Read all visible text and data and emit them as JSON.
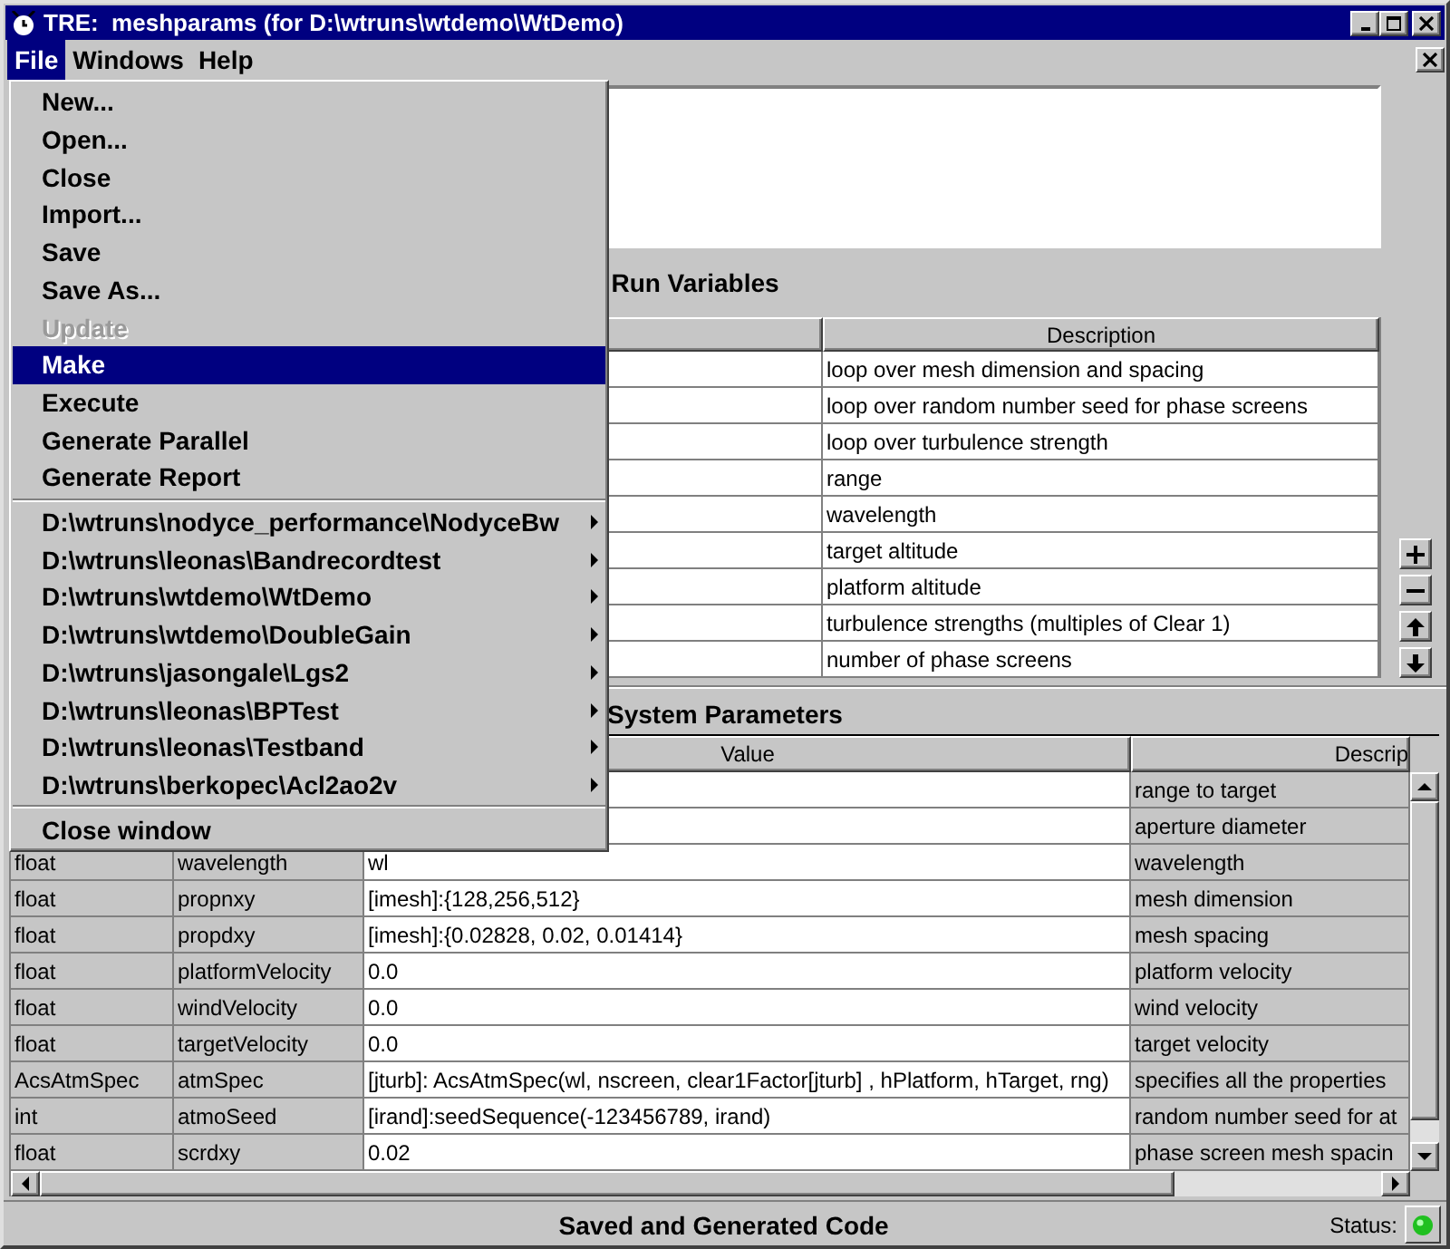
{
  "window": {
    "title": "TRE:  meshparams (for D:\\wtruns\\wtdemo\\WtDemo)"
  },
  "menubar": [
    {
      "label": "File",
      "selected": true
    },
    {
      "label": "Windows",
      "selected": false
    },
    {
      "label": "Help",
      "selected": false
    }
  ],
  "file_menu": {
    "groups": [
      [
        {
          "label": "New...",
          "kind": "command",
          "disabled": false,
          "selected": false
        },
        {
          "label": "Open...",
          "kind": "command",
          "disabled": false,
          "selected": false
        },
        {
          "label": "Close",
          "kind": "command",
          "disabled": false,
          "selected": false
        },
        {
          "label": "Import...",
          "kind": "command",
          "disabled": false,
          "selected": false
        },
        {
          "label": "Save",
          "kind": "command",
          "disabled": false,
          "selected": false
        },
        {
          "label": "Save As...",
          "kind": "command",
          "disabled": false,
          "selected": false
        },
        {
          "label": "Update",
          "kind": "command",
          "disabled": true,
          "selected": false
        },
        {
          "label": "Make",
          "kind": "command",
          "disabled": false,
          "selected": true
        },
        {
          "label": "Execute",
          "kind": "command",
          "disabled": false,
          "selected": false
        },
        {
          "label": "Generate Parallel",
          "kind": "command",
          "disabled": false,
          "selected": false
        },
        {
          "label": "Generate Report",
          "kind": "command",
          "disabled": false,
          "selected": false
        }
      ],
      [
        {
          "label": "D:\\wtruns\\nodyce_performance\\NodyceBw",
          "kind": "submenu",
          "disabled": false,
          "selected": false
        },
        {
          "label": "D:\\wtruns\\leonas\\Bandrecordtest",
          "kind": "submenu",
          "disabled": false,
          "selected": false
        },
        {
          "label": "D:\\wtruns\\wtdemo\\WtDemo",
          "kind": "submenu",
          "disabled": false,
          "selected": false
        },
        {
          "label": "D:\\wtruns\\wtdemo\\DoubleGain",
          "kind": "submenu",
          "disabled": false,
          "selected": false
        },
        {
          "label": "D:\\wtruns\\jasongale\\Lgs2",
          "kind": "submenu",
          "disabled": false,
          "selected": false
        },
        {
          "label": "D:\\wtruns\\leonas\\BPTest",
          "kind": "submenu",
          "disabled": false,
          "selected": false
        },
        {
          "label": "D:\\wtruns\\leonas\\Testband",
          "kind": "submenu",
          "disabled": false,
          "selected": false
        },
        {
          "label": "D:\\wtruns\\berkopec\\Acl2ao2v",
          "kind": "submenu",
          "disabled": false,
          "selected": false
        }
      ],
      [
        {
          "label": "Close window",
          "kind": "command",
          "disabled": false,
          "selected": false
        }
      ]
    ]
  },
  "run_variables": {
    "title": "Run Variables",
    "columns": [
      "Description"
    ],
    "rows": [
      {
        "description": "loop over mesh dimension and spacing"
      },
      {
        "description": "loop over random number seed for phase screens"
      },
      {
        "description": "loop over turbulence strength"
      },
      {
        "description": "range"
      },
      {
        "description": "wavelength"
      },
      {
        "description": "target altitude"
      },
      {
        "description": "platform altitude"
      },
      {
        "description": "turbulence strengths (multiples of Clear 1)"
      },
      {
        "description": "number of phase screens"
      }
    ],
    "buttons": [
      {
        "kind": "add"
      },
      {
        "kind": "remove"
      },
      {
        "kind": "up"
      },
      {
        "kind": "down"
      }
    ]
  },
  "system_parameters": {
    "title": "System Parameters",
    "columns": [
      "Value",
      "Descrip"
    ],
    "rows": [
      {
        "description": "range to target"
      },
      {
        "description": "aperture diameter"
      },
      {
        "type": "float",
        "name": "wavelength",
        "value": "wl",
        "description": "wavelength"
      },
      {
        "type": "float",
        "name": "propnxy",
        "value": "[imesh]:{128,256,512}",
        "description": "mesh dimension"
      },
      {
        "type": "float",
        "name": "propdxy",
        "value": "[imesh]:{0.02828, 0.02, 0.01414}",
        "description": "mesh spacing"
      },
      {
        "type": "float",
        "name": "platformVelocity",
        "value": "0.0",
        "description": "platform velocity"
      },
      {
        "type": "float",
        "name": "windVelocity",
        "value": "0.0",
        "description": "wind velocity"
      },
      {
        "type": "float",
        "name": "targetVelocity",
        "value": "0.0",
        "description": "target velocity"
      },
      {
        "type": "AcsAtmSpec",
        "name": "atmSpec",
        "value": "[jturb]: AcsAtmSpec(wl, nscreen, clear1Factor[jturb] , hPlatform, hTarget, rng)",
        "description": "specifies all the properties"
      },
      {
        "type": "int",
        "name": "atmoSeed",
        "value": "[irand]:seedSequence(-123456789, irand)",
        "description": "random number seed for at"
      },
      {
        "type": "float",
        "name": "scrdxy",
        "value": "0.02",
        "description": "phase screen mesh spacin"
      }
    ]
  },
  "status_bar": {
    "message": "Saved and Generated Code",
    "label": "Status:"
  }
}
